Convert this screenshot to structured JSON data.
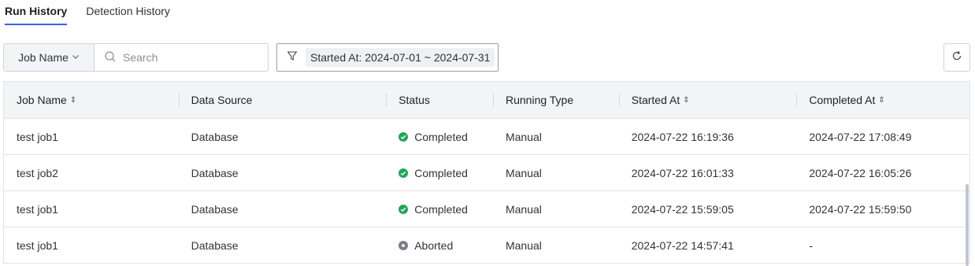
{
  "tabs": [
    {
      "label": "Run History",
      "active": true
    },
    {
      "label": "Detection History",
      "active": false
    }
  ],
  "toolbar": {
    "job_select_label": "Job Name",
    "search_placeholder": "Search",
    "filter_label": "Started At: 2024-07-01 ~ 2024-07-31",
    "icons": {
      "filter": "filter-icon",
      "search": "search-icon",
      "refresh": "refresh-icon"
    }
  },
  "table": {
    "columns": [
      "Job Name",
      "Data Source",
      "Status",
      "Running Type",
      "Started At",
      "Completed At"
    ],
    "sortable": [
      true,
      false,
      false,
      false,
      true,
      true
    ],
    "rows": [
      {
        "job": "test job1",
        "source": "Database",
        "status": "Completed",
        "status_kind": "completed",
        "type": "Manual",
        "started": "2024-07-22 16:19:36",
        "completed": "2024-07-22 17:08:49"
      },
      {
        "job": "test job2",
        "source": "Database",
        "status": "Completed",
        "status_kind": "completed",
        "type": "Manual",
        "started": "2024-07-22 16:01:33",
        "completed": "2024-07-22 16:05:26"
      },
      {
        "job": "test job1",
        "source": "Database",
        "status": "Completed",
        "status_kind": "completed",
        "type": "Manual",
        "started": "2024-07-22 15:59:05",
        "completed": "2024-07-22 15:59:50"
      },
      {
        "job": "test job1",
        "source": "Database",
        "status": "Aborted",
        "status_kind": "aborted",
        "type": "Manual",
        "started": "2024-07-22 14:57:41",
        "completed": "-"
      }
    ]
  },
  "colors": {
    "accent": "#3a64d8",
    "completed": "#22a55b",
    "aborted": "#7a7f86"
  }
}
